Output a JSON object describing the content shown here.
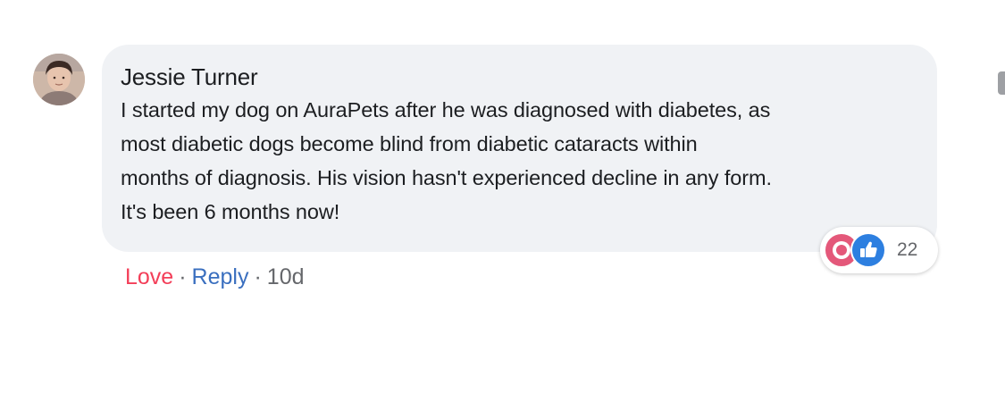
{
  "comment": {
    "author": "Jessie Turner",
    "text": "I started my dog on AuraPets after he was diagnosed with diabetes, as\nmost diabetic dogs become blind from diabetic cataracts within\nmonths of diagnosis. His vision hasn't experienced decline in any form.\nIt's been 6 months now!",
    "reactions": {
      "icons": [
        "care-icon",
        "like-icon"
      ],
      "count": "22",
      "colors": {
        "care": "#e4587a",
        "like": "#2d7fe0"
      }
    },
    "actions": {
      "love_label": "Love",
      "separator": "·",
      "reply_label": "Reply",
      "timestamp": "10d"
    }
  },
  "colors": {
    "bubble_bg": "#f0f2f5",
    "love": "#f33e58",
    "reply": "#3a6fbf",
    "meta": "#65676b"
  }
}
